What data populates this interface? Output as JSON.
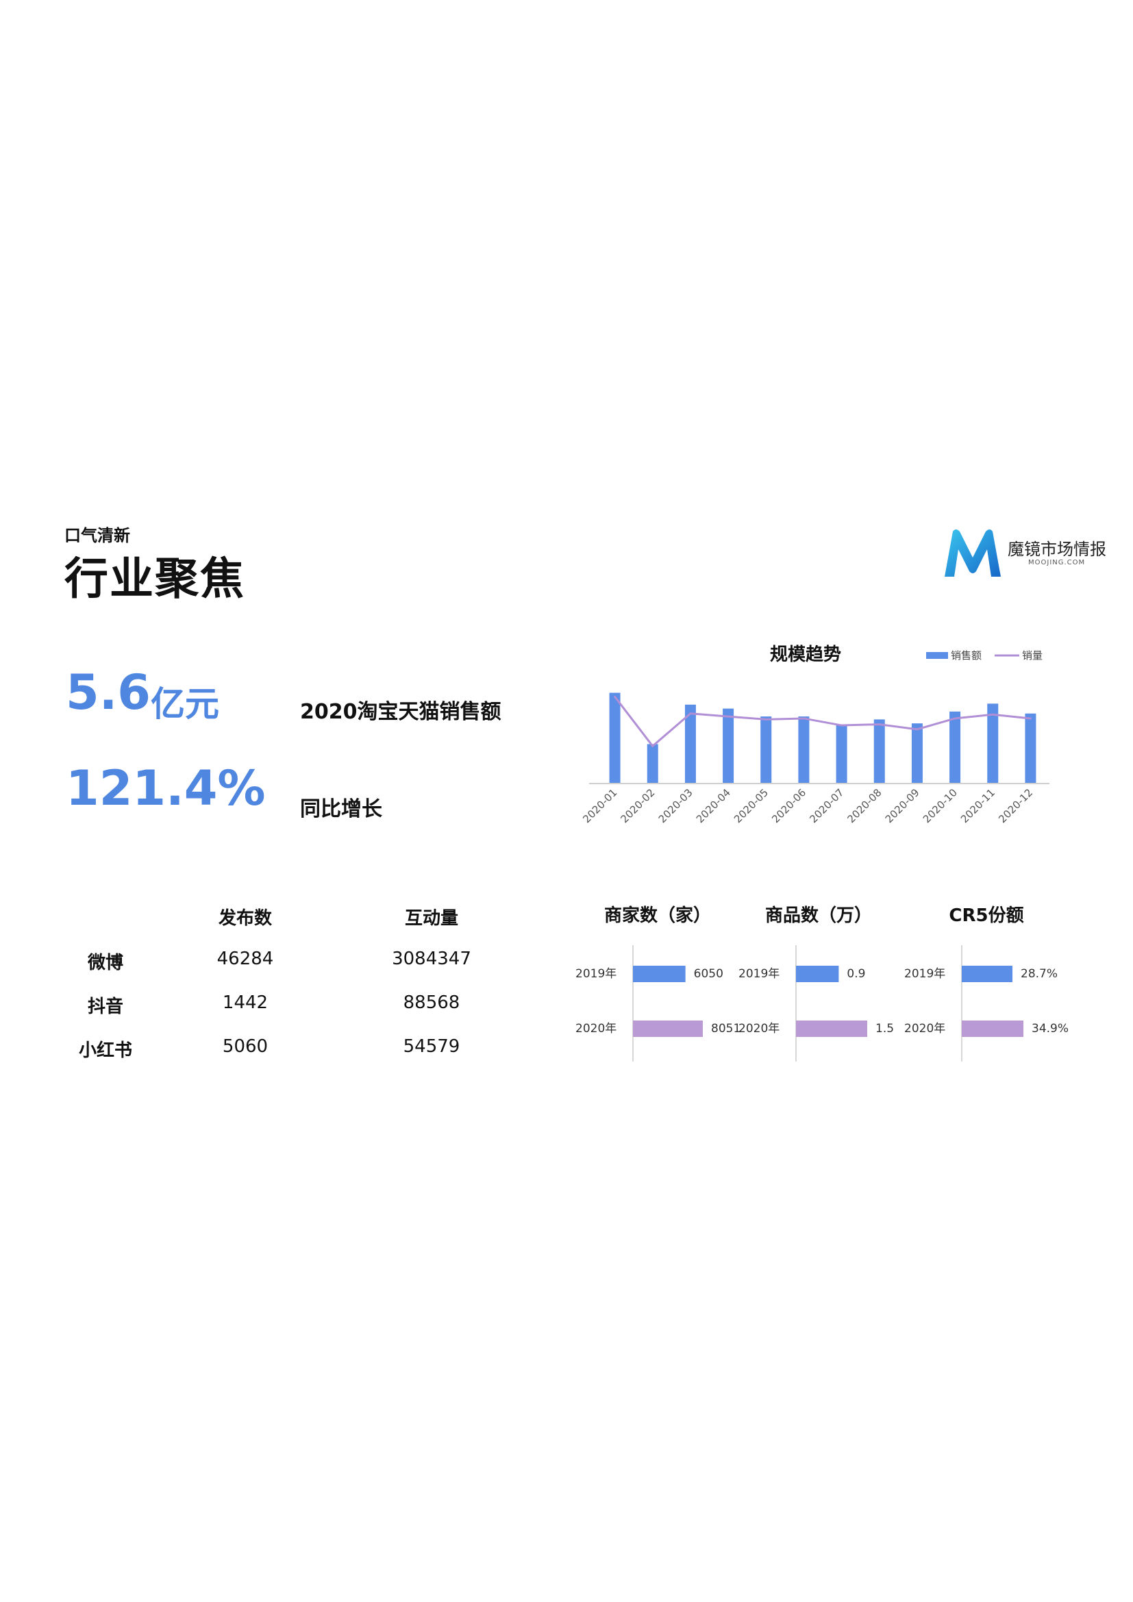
{
  "header": {
    "category": "口气清新",
    "title": "行业聚焦"
  },
  "logo": {
    "name": "魔镜市场情报",
    "url": "MOOJING.COM",
    "colors": [
      "#2bb3e6",
      "#1a6fd1"
    ]
  },
  "kpis": [
    {
      "value": "5.6",
      "unit": "亿元",
      "label": "2020淘宝天猫销售额"
    },
    {
      "value": "121.4%",
      "unit": "",
      "label": "同比增长"
    }
  ],
  "social_table": {
    "headers": [
      "发布数",
      "互动量"
    ],
    "rows": [
      {
        "platform": "微博",
        "posts": "46284",
        "interactions": "3084347"
      },
      {
        "platform": "抖音",
        "posts": "1442",
        "interactions": "88568"
      },
      {
        "platform": "小红书",
        "posts": "5060",
        "interactions": "54579"
      }
    ]
  },
  "colors": {
    "accent": "#4f86e0",
    "bar": "#5b8ee6",
    "line": "#b18fd6",
    "bar2020": "#b99ad4"
  },
  "chart_data": [
    {
      "type": "bar",
      "title": "规模趋势",
      "legend_position": "top-right",
      "categories": [
        "2020-01",
        "2020-02",
        "2020-03",
        "2020-04",
        "2020-05",
        "2020-06",
        "2020-07",
        "2020-08",
        "2020-09",
        "2020-10",
        "2020-11",
        "2020-12"
      ],
      "series": [
        {
          "name": "销售额",
          "type": "bar",
          "values": [
            92,
            40,
            80,
            76,
            68,
            68,
            60,
            65,
            61,
            73,
            81,
            71
          ]
        },
        {
          "name": "销量",
          "type": "line",
          "values": [
            88,
            38,
            71,
            68,
            65,
            66,
            59,
            60,
            55,
            66,
            70,
            66
          ]
        }
      ],
      "ylim": [
        0,
        100
      ],
      "grid": false
    },
    {
      "type": "bar",
      "orientation": "horizontal",
      "title": "商家数（家）",
      "categories": [
        "2019年",
        "2020年"
      ],
      "values": [
        6050,
        8051
      ],
      "value_labels": [
        "6050",
        "8051"
      ]
    },
    {
      "type": "bar",
      "orientation": "horizontal",
      "title": "商品数（万）",
      "categories": [
        "2019年",
        "2020年"
      ],
      "values": [
        0.9,
        1.5
      ],
      "value_labels": [
        "0.9",
        "1.5"
      ]
    },
    {
      "type": "bar",
      "orientation": "horizontal",
      "title": "CR5份额",
      "categories": [
        "2019年",
        "2020年"
      ],
      "values": [
        28.7,
        34.9
      ],
      "value_labels": [
        "28.7%",
        "34.9%"
      ]
    }
  ]
}
